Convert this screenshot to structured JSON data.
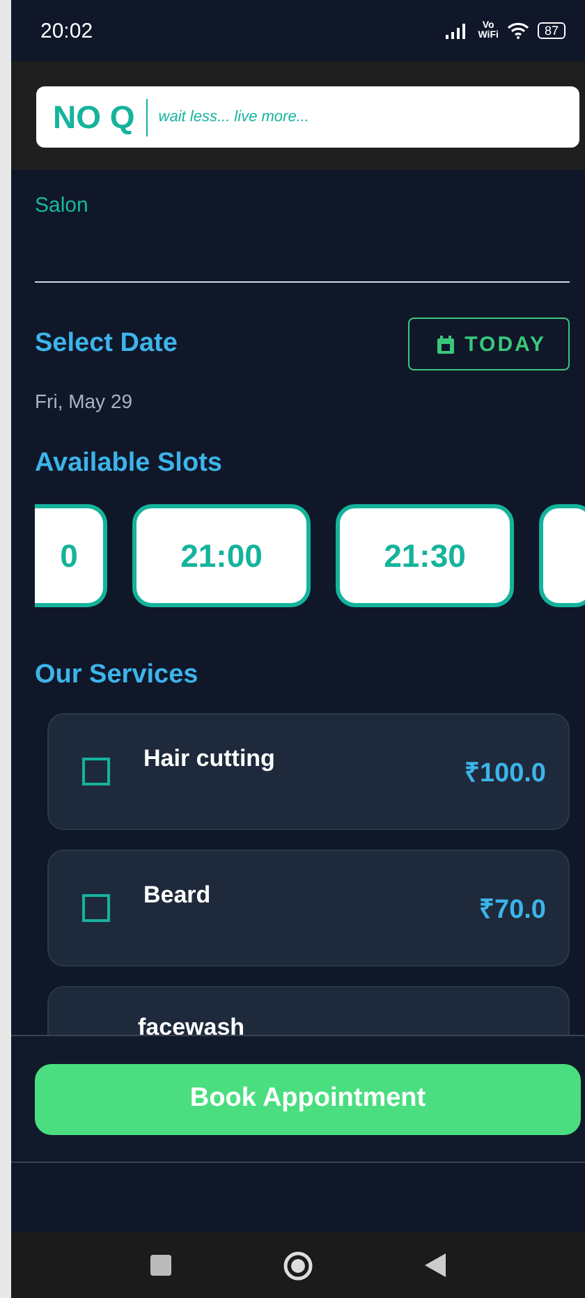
{
  "status_bar": {
    "time": "20:02",
    "network": "Vo\nWiFi",
    "battery": "87"
  },
  "header": {
    "logo": "NO Q",
    "tagline": "wait less... live more..."
  },
  "shop": {
    "category": "Salon"
  },
  "date_section": {
    "title": "Select Date",
    "button": "TODAY",
    "date": "Fri, May 29"
  },
  "slots_section": {
    "title": "Available Slots",
    "slots": [
      {
        "time": "0",
        "selected": false
      },
      {
        "time": "21:00",
        "selected": false
      },
      {
        "time": "21:30",
        "selected": false
      },
      {
        "selected": false
      }
    ]
  },
  "services_section": {
    "title": "Our Services",
    "services": [
      {
        "name": "Hair cutting",
        "price": "₹100.0",
        "checked": false
      },
      {
        "name": "Beard",
        "price": "₹70.0",
        "checked": false
      },
      {
        "name": "facewash"
      }
    ]
  },
  "book_button": "Book Appointment"
}
